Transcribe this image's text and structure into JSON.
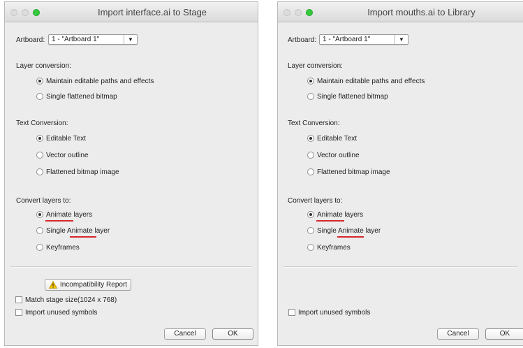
{
  "dialogs": [
    {
      "title": "Import interface.ai to Stage",
      "artboard_label": "Artboard:",
      "artboard_value": "1 - \"Artboard 1\"",
      "layer_conversion": {
        "heading": "Layer conversion:",
        "options": [
          "Maintain editable paths and effects",
          "Single flattened bitmap"
        ],
        "selected": 0
      },
      "text_conversion": {
        "heading": "Text Conversion:",
        "options": [
          "Editable Text",
          "Vector outline",
          "Flattened bitmap image"
        ],
        "selected": 0
      },
      "convert_layers": {
        "heading": "Convert layers to:",
        "options": [
          "Animate layers",
          "Single Animate layer",
          "Keyframes"
        ],
        "selected": 0
      },
      "incompatibility_button": "Incompatibility Report",
      "match_stage_size": "Match stage size(1024 x 768)",
      "import_unused_symbols": "Import unused symbols",
      "cancel_label": "Cancel",
      "ok_label": "OK"
    },
    {
      "title": "Import mouths.ai to Library",
      "artboard_label": "Artboard:",
      "artboard_value": "1 - \"Artboard 1\"",
      "layer_conversion": {
        "heading": "Layer conversion:",
        "options": [
          "Maintain editable paths and effects",
          "Single flattened bitmap"
        ],
        "selected": 0
      },
      "text_conversion": {
        "heading": "Text Conversion:",
        "options": [
          "Editable Text",
          "Vector outline",
          "Flattened bitmap image"
        ],
        "selected": 0
      },
      "convert_layers": {
        "heading": "Convert layers to:",
        "options": [
          "Animate layers",
          "Single Animate layer",
          "Keyframes"
        ],
        "selected": 0
      },
      "import_unused_symbols": "Import unused symbols",
      "cancel_label": "Cancel",
      "ok_label": "OK"
    }
  ],
  "colors": {
    "window_bg": "#ececec",
    "highlight_underline": "#d7262c",
    "zoom_light": "#35c93c",
    "warning_icon": "#f5c400"
  },
  "icons": [
    "warning-icon",
    "dropdown-arrow-icon"
  ]
}
